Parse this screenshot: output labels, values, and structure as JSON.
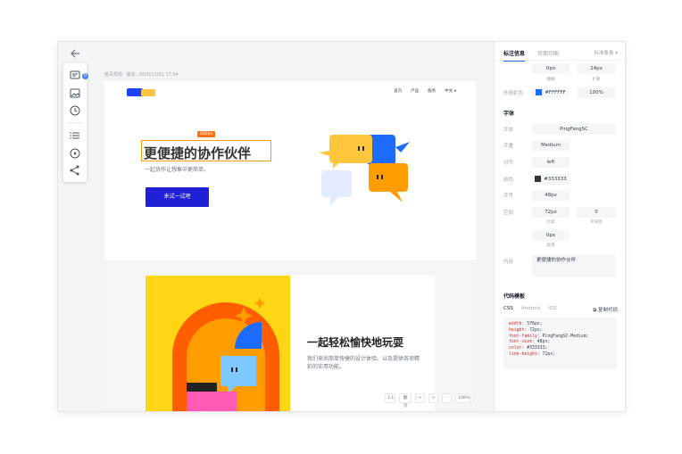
{
  "breadcrumb": "首页规范 · 版本: 2020/11/01 17:54",
  "toolbar": {
    "badge": "0"
  },
  "site": {
    "nav": [
      "首页",
      "产品",
      "服务",
      "中文 ▾"
    ],
    "hero_title": "更便捷的协作伙伴",
    "selection_tag": "480px",
    "hero_sub": "一起协作让想象中更简单。",
    "cta": "来试一试吧",
    "card_title": "一起轻松愉快地玩耍",
    "card_text": "我们来尚简单快捷的设计体验。以及提供各项精彩的实用功能。"
  },
  "pager": [
    "1:1",
    "翻页",
    "<",
    ">",
    "-",
    "100%",
    "+"
  ],
  "panel": {
    "tabs": [
      "标注信息",
      "页面切图"
    ],
    "unit": "标准像素 ▾",
    "blur_value": "0px",
    "blur_label": "模糊",
    "spread_value": "24px",
    "spread_label": "扩散",
    "shadow_color_label": "外投影色",
    "shadow_color": "#FFFFFF",
    "shadow_opacity": "100%",
    "font_section": "字体",
    "font_label": "字体",
    "font_value": "PingFangSC",
    "weight_label": "字重",
    "weight_value": "Medium",
    "align_label": "对齐",
    "align_value": "left",
    "color_label": "颜色",
    "color_value": "#333333",
    "size_label": "字号",
    "size_value": "48px",
    "spacing_label": "空间",
    "line_height": "72px",
    "line_height_label": "行高",
    "letter_spacing": "0",
    "letter_spacing_label": "字间距",
    "para_value": "0px",
    "para_label": "段落",
    "content_label": "内容",
    "content_value": "更便捷的协作伙伴",
    "code_section": "代码模板",
    "code_tabs": [
      "CSS",
      "Android",
      "iOS"
    ],
    "copy": "复制代码",
    "code": [
      {
        "k": "width:",
        "v": " 576px;"
      },
      {
        "k": "height:",
        "v": " 72px;"
      },
      {
        "k": "font-family:",
        "v": " PingFangSC-Medium;"
      },
      {
        "k": "font-size:",
        "v": " 48px;"
      },
      {
        "k": "color:",
        "v": " #333333;"
      },
      {
        "k": "line-height:",
        "v": " 72px;"
      }
    ]
  },
  "colors": {
    "brand_blue": "#1f1fd6",
    "accent_yellow": "#ffd615",
    "accent_orange": "#f97316",
    "text_dark": "#333333"
  }
}
